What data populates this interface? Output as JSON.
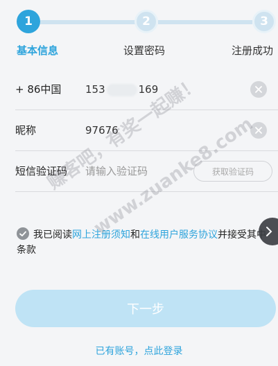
{
  "steps": [
    {
      "number": "1",
      "label": "基本信息",
      "state": "active"
    },
    {
      "number": "2",
      "label": "设置密码",
      "state": "inactive"
    },
    {
      "number": "3",
      "label": "注册成功",
      "state": "inactive"
    }
  ],
  "form": {
    "phone": {
      "label": "+ 86中国",
      "value_start": "153",
      "value_end": "169"
    },
    "nickname": {
      "label": "昵称",
      "value": "97676"
    },
    "sms": {
      "label": "短信验证码",
      "placeholder": "请输入验证码",
      "button": "获取验证码"
    }
  },
  "agreement": {
    "prefix": "我已阅读",
    "link1": "网上注册须知",
    "middle": "和",
    "link2": "在线用户服务协议",
    "suffix": "并接受其中条款"
  },
  "next_button": "下一步",
  "login_link": "已有账号，点此登录",
  "watermark": {
    "line1": "赚客吧，有奖一起赚！",
    "line2": "www.zuanke8.com"
  },
  "colors": {
    "accent": "#2ea4dc",
    "disabled_button": "#bfe3f5"
  }
}
